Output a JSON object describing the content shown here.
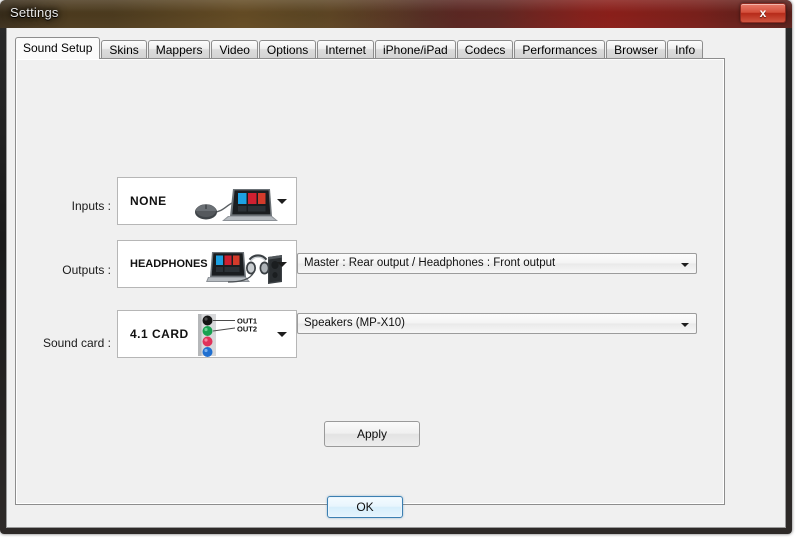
{
  "window": {
    "title": "Settings",
    "close_label": "x"
  },
  "tabs": [
    {
      "label": "Sound Setup",
      "selected": true
    },
    {
      "label": "Skins",
      "selected": false
    },
    {
      "label": "Mappers",
      "selected": false
    },
    {
      "label": "Video",
      "selected": false
    },
    {
      "label": "Options",
      "selected": false
    },
    {
      "label": "Internet",
      "selected": false
    },
    {
      "label": "iPhone/iPad",
      "selected": false
    },
    {
      "label": "Codecs",
      "selected": false
    },
    {
      "label": "Performances",
      "selected": false
    },
    {
      "label": "Browser",
      "selected": false
    },
    {
      "label": "Info",
      "selected": false
    }
  ],
  "sound_setup": {
    "inputs": {
      "label": "Inputs :",
      "value": "NONE",
      "icon": "laptop-mouse-icon"
    },
    "outputs": {
      "label": "Outputs :",
      "value": "HEADPHONES",
      "icon": "laptop-headphones-speaker-icon",
      "routing": "Master : Rear output / Headphones : Front output"
    },
    "sound_card": {
      "label": "Sound card :",
      "value": "4.1 CARD",
      "icon": "audio-jacks-icon",
      "jack_labels": [
        "OUT1",
        "OUT2"
      ],
      "device": "Speakers (MP-X10)"
    },
    "apply_label": "Apply"
  },
  "footer": {
    "ok_label": "OK"
  },
  "colors": {
    "accent_blue": "#3c7fb1",
    "close_red": "#c23520",
    "panel_bg": "#f0f0f0",
    "jack_black": "#1c1c1c",
    "jack_green": "#21a04c",
    "jack_pink": "#e2365c",
    "jack_blue": "#1f6fd0"
  }
}
